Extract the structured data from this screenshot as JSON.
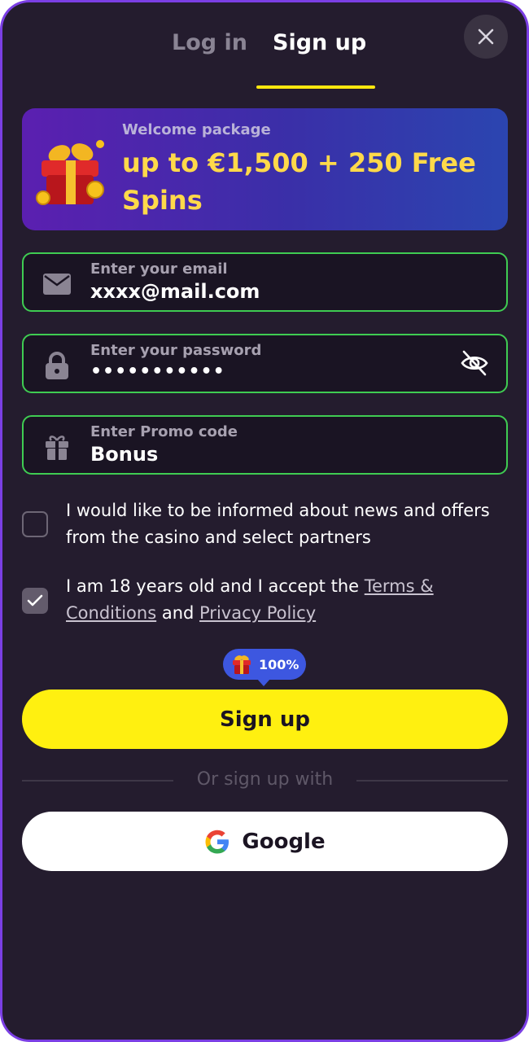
{
  "tabs": {
    "login": "Log in",
    "signup": "Sign up"
  },
  "banner": {
    "subtitle": "Welcome package",
    "title": "up to €1,500 + 250 Free Spins"
  },
  "fields": {
    "email": {
      "label": "Enter your email",
      "value": "xxxx@mail.com"
    },
    "password": {
      "label": "Enter your password",
      "value": "•••••••••••"
    },
    "promo": {
      "label": "Enter Promo code",
      "value": "Bonus"
    }
  },
  "consents": {
    "news": {
      "text": "I would like to be informed about news and offers from the casino and select partners",
      "checked": false
    },
    "age": {
      "text_before": "I am 18 years old and I accept the ",
      "terms_link": "Terms & Conditions",
      "text_middle": " and ",
      "privacy_link": "Privacy Policy",
      "checked": true
    }
  },
  "bonus_badge": {
    "percent": "100%"
  },
  "primary_button": "Sign up",
  "divider": "Or sign up with",
  "google_button": "Google",
  "colors": {
    "accent_yellow": "#fff010",
    "valid_green": "#3fcc52",
    "background": "#241c2e",
    "frame_purple": "#7b3fe4"
  }
}
